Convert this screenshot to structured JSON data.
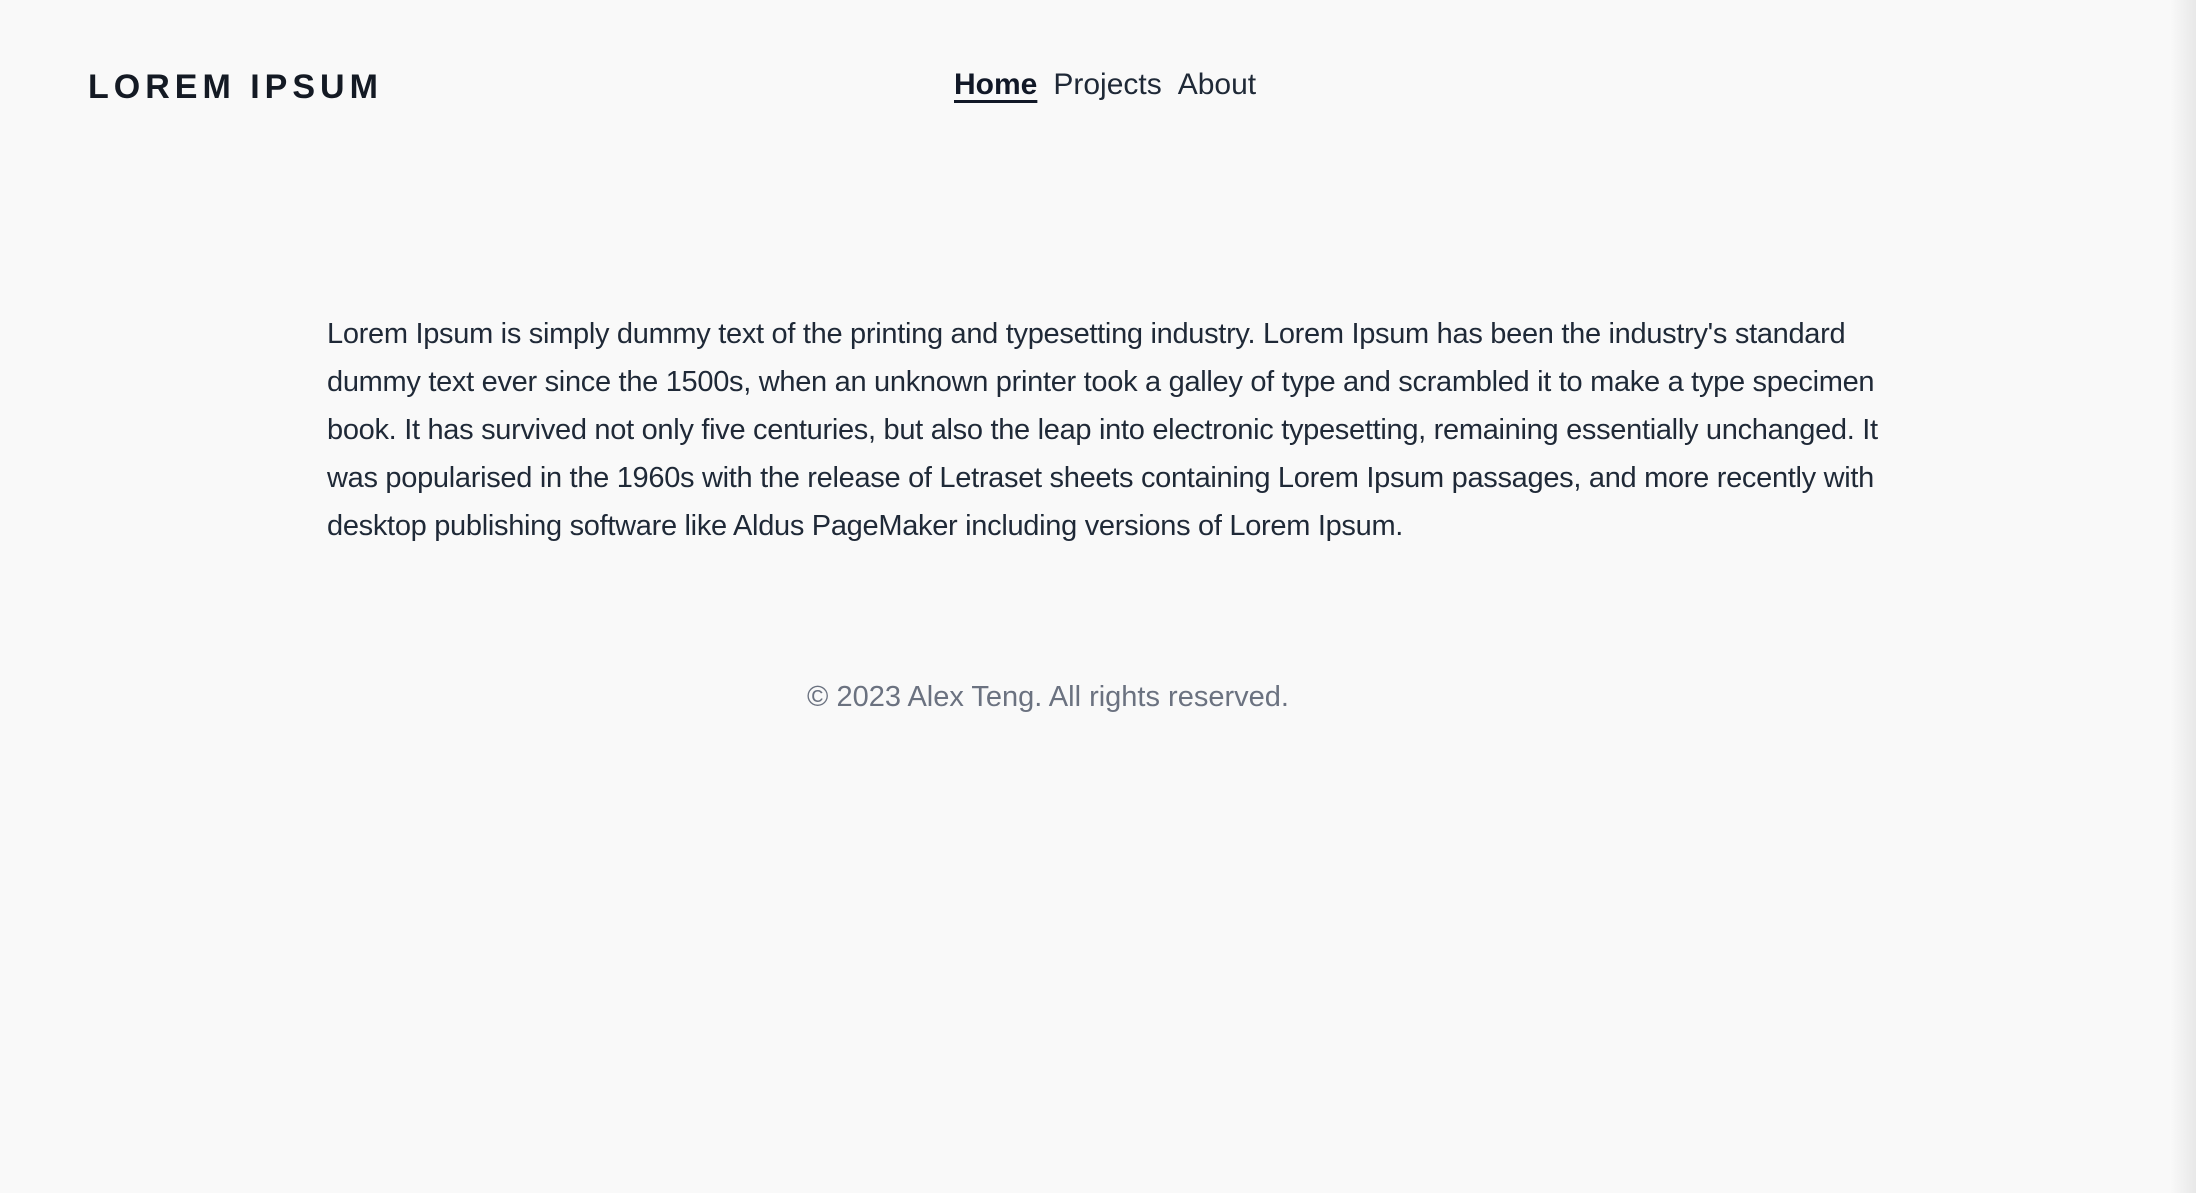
{
  "header": {
    "logo": "LOREM IPSUM",
    "nav": [
      {
        "label": "Home",
        "active": true
      },
      {
        "label": "Projects",
        "active": false
      },
      {
        "label": "About",
        "active": false
      }
    ]
  },
  "main": {
    "paragraph": "Lorem Ipsum is simply dummy text of the printing and typesetting industry. Lorem Ipsum has been the industry's standard dummy text ever since the 1500s, when an unknown printer took a galley of type and scrambled it to make a type specimen book. It has survived not only five centuries, but also the leap into electronic typesetting, remaining essentially unchanged. It was popularised in the 1960s with the release of Letraset sheets containing Lorem Ipsum passages, and more recently with desktop publishing software like Aldus PageMaker including versions of Lorem Ipsum."
  },
  "footer": {
    "copyright": "© 2023 Alex Teng. All rights reserved."
  },
  "colors": {
    "background": "#f9f9f9",
    "text": "#1f2937",
    "muted": "#6b7280"
  }
}
